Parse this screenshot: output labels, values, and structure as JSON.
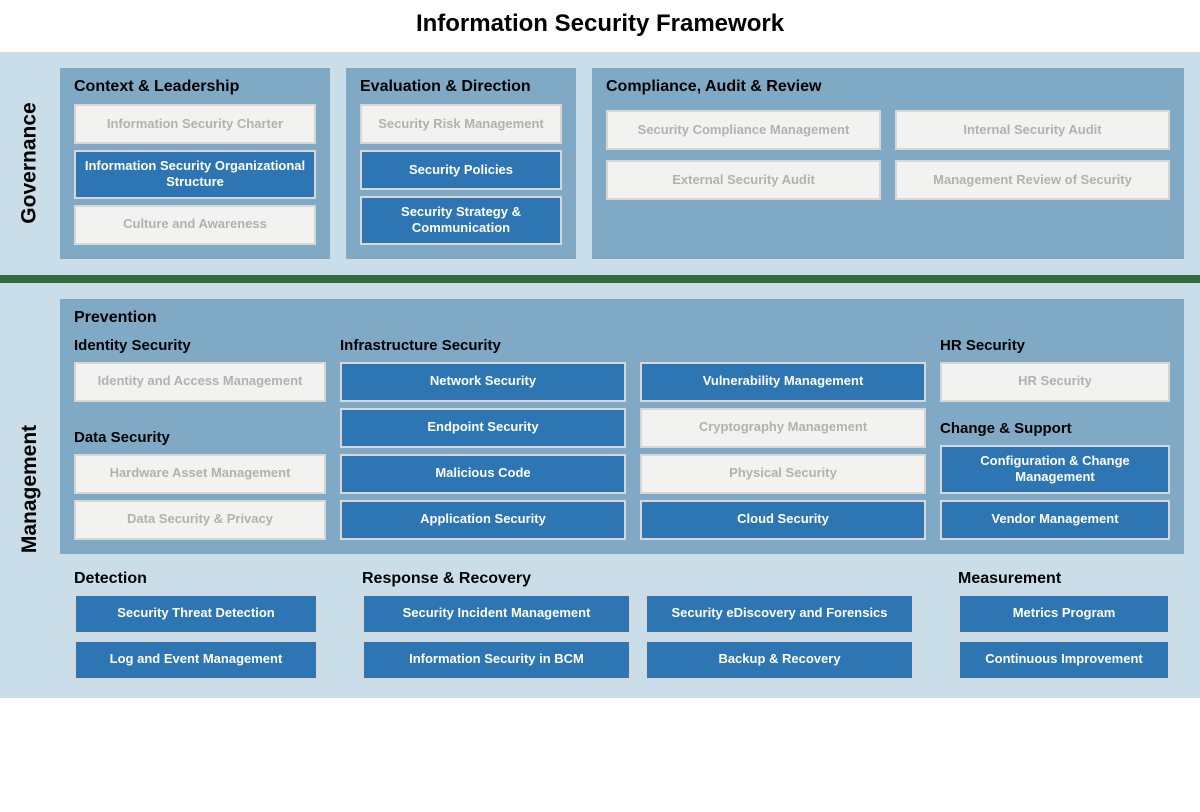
{
  "title": "Information Security Framework",
  "rows": {
    "governance": {
      "label": "Governance",
      "blocks": {
        "context": {
          "title": "Context & Leadership",
          "items": [
            {
              "label": "Information Security Charter",
              "active": false
            },
            {
              "label": "Information Security Organizational Structure",
              "active": true
            },
            {
              "label": "Culture and Awareness",
              "active": false
            }
          ]
        },
        "evaluation": {
          "title": "Evaluation & Direction",
          "items": [
            {
              "label": "Security Risk Management",
              "active": false
            },
            {
              "label": "Security Policies",
              "active": true
            },
            {
              "label": "Security Strategy & Communication",
              "active": true
            }
          ]
        },
        "compliance": {
          "title": "Compliance, Audit & Review",
          "items": [
            {
              "label": "Security Compliance Management",
              "active": false
            },
            {
              "label": "Internal Security Audit",
              "active": false
            },
            {
              "label": "External Security Audit",
              "active": false
            },
            {
              "label": "Management Review of Security",
              "active": false
            }
          ]
        }
      }
    },
    "management": {
      "label": "Management",
      "prevention": {
        "title": "Prevention",
        "groups": {
          "identity": {
            "title": "Identity Security",
            "items": [
              {
                "label": "Identity and Access Management",
                "active": false
              }
            ]
          },
          "data": {
            "title": "Data Security",
            "items": [
              {
                "label": "Hardware Asset Management",
                "active": false
              },
              {
                "label": "Data Security & Privacy",
                "active": false
              }
            ]
          },
          "infra": {
            "title": "Infrastructure Security",
            "colA": [
              {
                "label": "Network Security",
                "active": true
              },
              {
                "label": "Endpoint Security",
                "active": true
              },
              {
                "label": "Malicious Code",
                "active": true
              },
              {
                "label": "Application Security",
                "active": true
              }
            ],
            "colB": [
              {
                "label": "Vulnerability Management",
                "active": true
              },
              {
                "label": "Cryptography Management",
                "active": false
              },
              {
                "label": "Physical Security",
                "active": false
              },
              {
                "label": "Cloud Security",
                "active": true
              }
            ]
          },
          "hr": {
            "title": "HR Security",
            "items": [
              {
                "label": "HR Security",
                "active": false
              }
            ]
          },
          "change": {
            "title": "Change & Support",
            "items": [
              {
                "label": "Configuration & Change Management",
                "active": true
              },
              {
                "label": "Vendor Management",
                "active": true
              }
            ]
          }
        }
      },
      "detection": {
        "title": "Detection",
        "items": [
          {
            "label": "Security Threat Detection",
            "active": true
          },
          {
            "label": "Log and Event Management",
            "active": true
          }
        ]
      },
      "response": {
        "title": "Response & Recovery",
        "colA": [
          {
            "label": "Security Incident Management",
            "active": true
          },
          {
            "label": "Information Security in BCM",
            "active": true
          }
        ],
        "colB": [
          {
            "label": "Security eDiscovery and Forensics",
            "active": true
          },
          {
            "label": "Backup & Recovery",
            "active": true
          }
        ]
      },
      "measurement": {
        "title": "Measurement",
        "items": [
          {
            "label": "Metrics Program",
            "active": true
          },
          {
            "label": "Continuous Improvement",
            "active": true
          }
        ]
      }
    }
  }
}
